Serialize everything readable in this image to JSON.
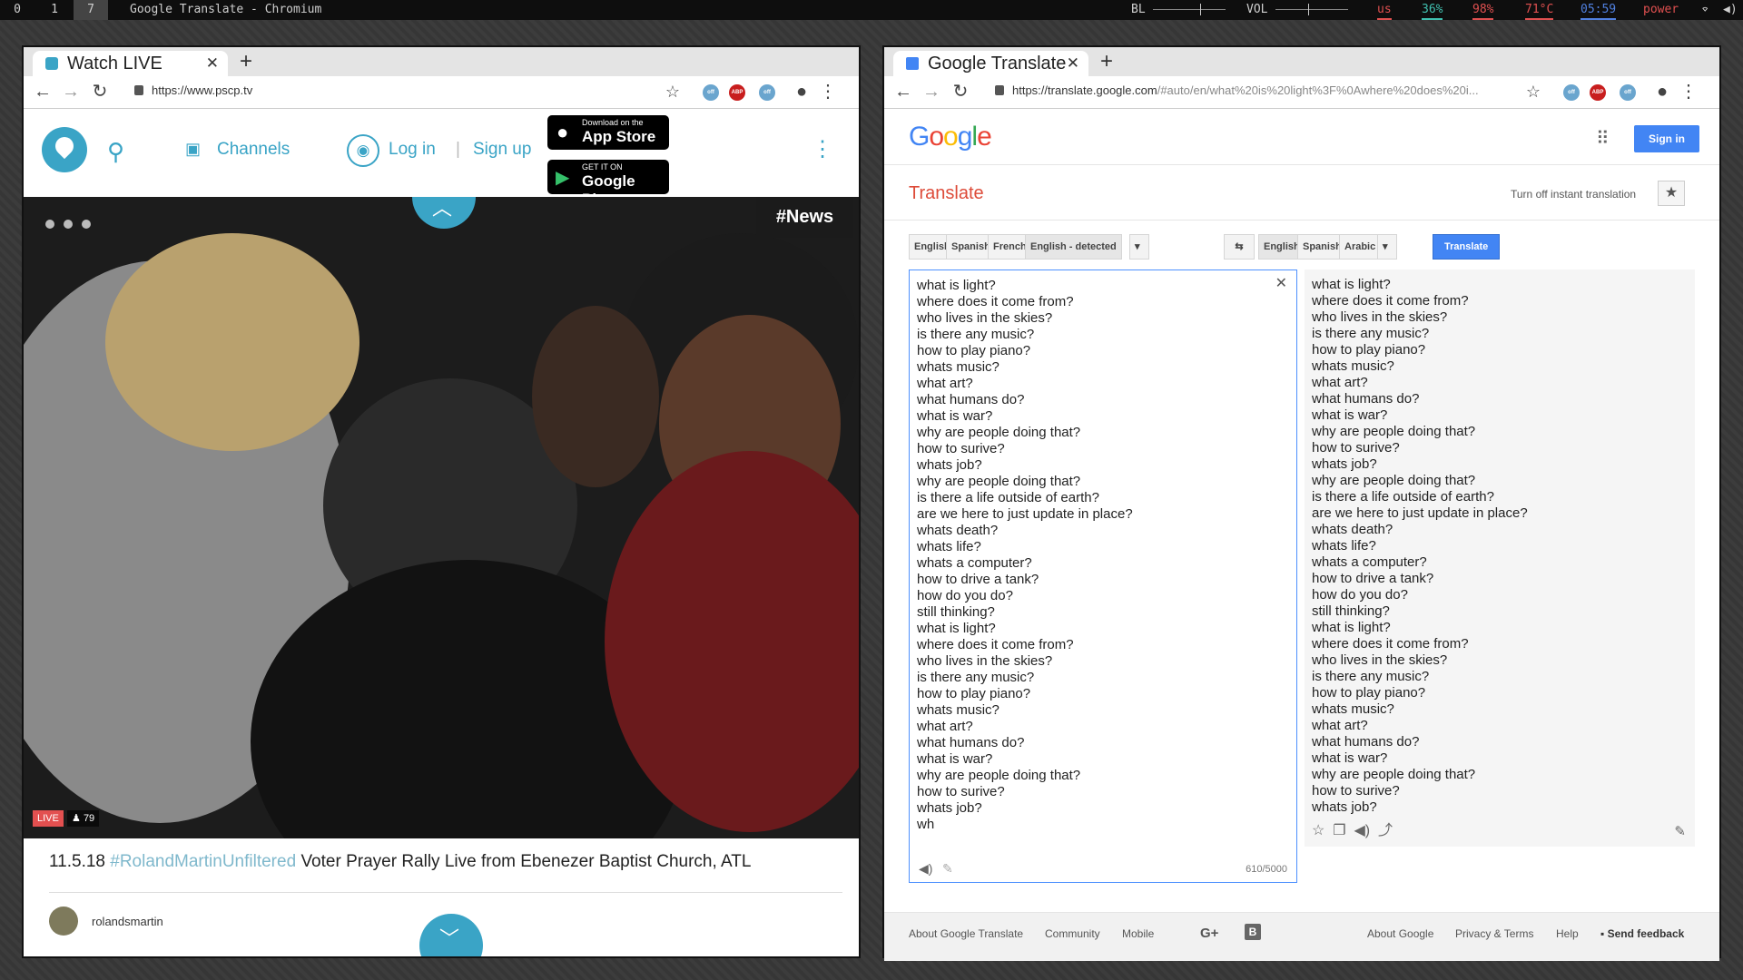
{
  "topbar": {
    "workspaces": [
      "0",
      "1",
      "7"
    ],
    "window_title": "Google Translate - Chromium",
    "bl_label": "BL",
    "vol_label": "VOL",
    "bl_level": 0.65,
    "vol_level": 0.45,
    "stats": [
      {
        "text": "us",
        "color": "#e05050"
      },
      {
        "text": "36%",
        "color": "#40c0b0"
      },
      {
        "text": "98%",
        "color": "#e05050"
      },
      {
        "text": "71°C",
        "color": "#e05050"
      },
      {
        "text": "05:59",
        "color": "#5080e0"
      },
      {
        "text": "power",
        "color": "#e05050"
      }
    ]
  },
  "left_window": {
    "tab_title": "Watch LIVE",
    "url": "https://www.pscp.tv",
    "header": {
      "channels": "Channels",
      "login": "Log in",
      "separator": "|",
      "signup": "Sign up",
      "appstore_small": "Download on the",
      "appstore_big": "App Store",
      "play_small": "GET IT ON",
      "play_big": "Google Play"
    },
    "video": {
      "tag": "#News",
      "live_label": "LIVE",
      "viewers": "79",
      "date": "11.5.18",
      "hashtag": "#RolandMartinUnfiltered",
      "title_rest": "Voter Prayer Rally Live from Ebenezer Baptist Church, ATL",
      "user": "rolandsmartin"
    }
  },
  "right_window": {
    "tab_title": "Google Translate",
    "url_host": "https://translate.google.com",
    "url_rest": "/#auto/en/what%20is%20light%3F%0Awhere%20does%20i...",
    "logo": [
      "G",
      "o",
      "o",
      "g",
      "l",
      "e"
    ],
    "logo_colors": [
      "#4285f4",
      "#ea4335",
      "#fbbc05",
      "#4285f4",
      "#34a853",
      "#ea4335"
    ],
    "sign_in": "Sign in",
    "translate_title": "Translate",
    "instant": "Turn off instant translation",
    "src_langs": [
      "English",
      "Spanish",
      "French",
      "English - detected"
    ],
    "tgt_langs": [
      "English",
      "Spanish",
      "Arabic"
    ],
    "translate_button": "Translate",
    "char_count": "610/5000",
    "source_lines": [
      "what is light?",
      "where does it come from?",
      "who lives in the skies?",
      "is there any music?",
      "how to play piano?",
      "whats music?",
      "what art?",
      "what humans do?",
      "what is war?",
      "why are people doing that?",
      "how to surive?",
      "whats job?",
      "why are people doing that?",
      "is there a life outside of earth?",
      "are we here to just update in place?",
      "whats death?",
      "whats life?",
      "whats a computer?",
      "how to drive a tank?",
      "how do you do?",
      "still thinking?",
      "what is light?",
      "where does it come from?",
      "who lives in the skies?",
      "is there any music?",
      "how to play piano?",
      "whats music?",
      "what art?",
      "what humans do?",
      "what is war?",
      "why are people doing that?",
      "how to surive?",
      "whats job?",
      "wh"
    ],
    "target_lines": [
      "what is light?",
      "where does it come from?",
      "who lives in the skies?",
      "is there any music?",
      "how to play piano?",
      "whats music?",
      "what art?",
      "what humans do?",
      "what is war?",
      "why are people doing that?",
      "how to surive?",
      "whats job?",
      "why are people doing that?",
      "is there a life outside of earth?",
      "are we here to just update in place?",
      "whats death?",
      "whats life?",
      "whats a computer?",
      "how to drive a tank?",
      "how do you do?",
      "still thinking?",
      "what is light?",
      "where does it come from?",
      "who lives in the skies?",
      "is there any music?",
      "how to play piano?",
      "whats music?",
      "what art?",
      "what humans do?",
      "what is war?",
      "why are people doing that?",
      "how to surive?",
      "whats job?"
    ],
    "footer": {
      "about_translate": "About Google Translate",
      "community": "Community",
      "mobile": "Mobile",
      "gplus": "G+",
      "about_google": "About Google",
      "privacy": "Privacy & Terms",
      "help": "Help",
      "feedback": "Send feedback"
    }
  }
}
